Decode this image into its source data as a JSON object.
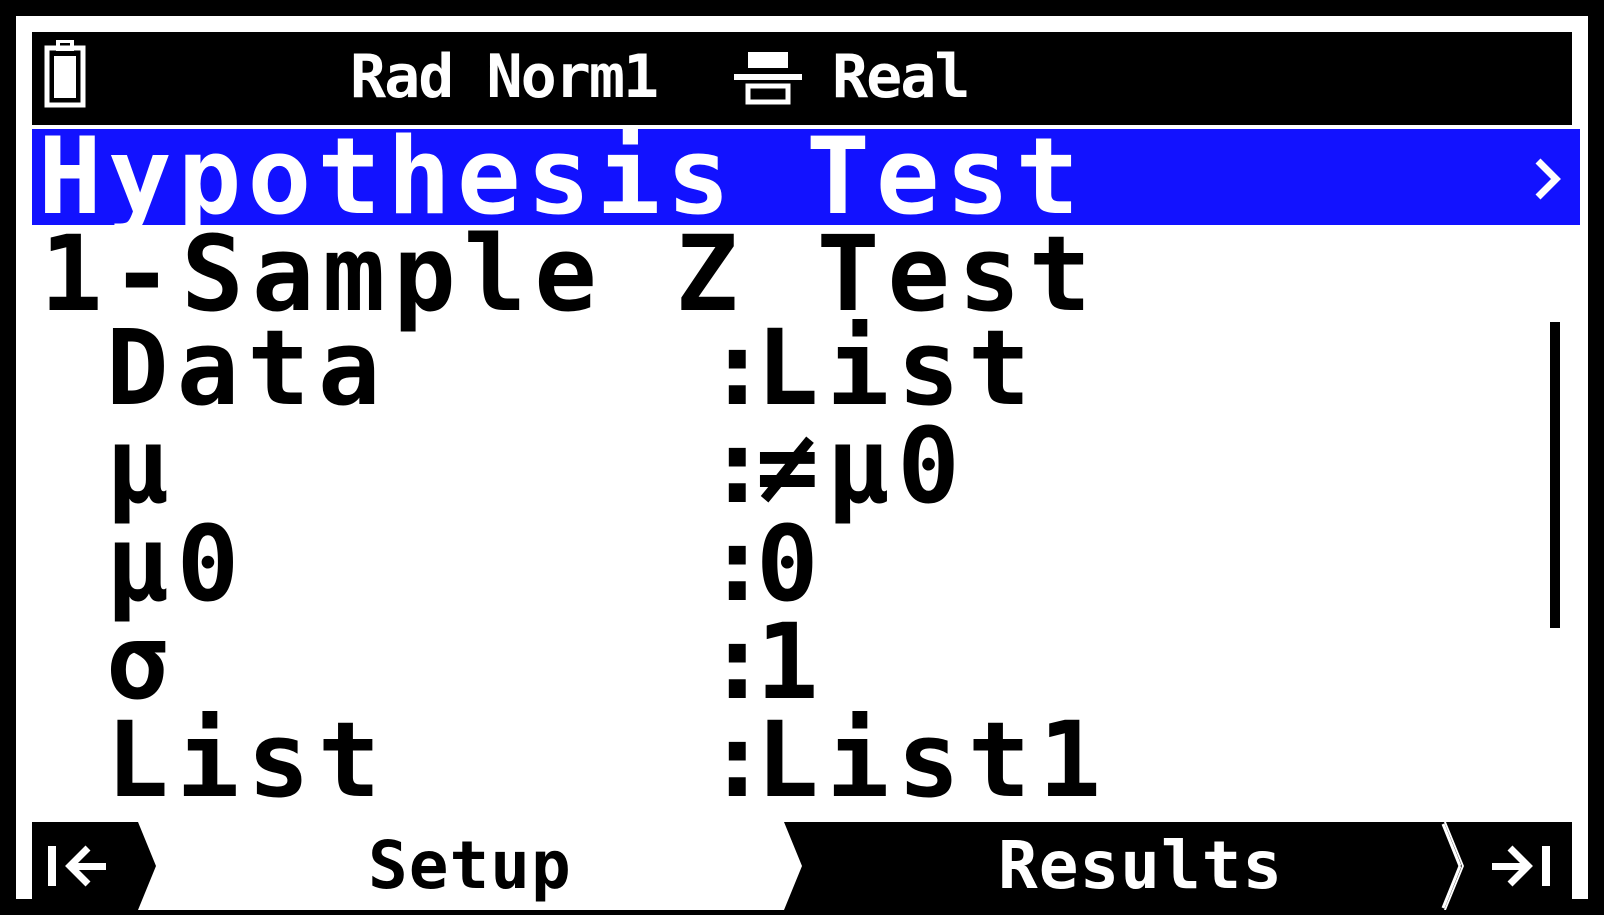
{
  "status": {
    "angle_mode": "Rad",
    "display_mode": "Norm1",
    "complex_mode": "Real",
    "battery_icon": "battery-icon",
    "display_icon": "fraction-display-icon"
  },
  "title": {
    "text": "Hypothesis Test",
    "chevron_icon": "chevron-right-icon"
  },
  "test": {
    "name": "1-Sample Z Test",
    "rows": [
      {
        "label": "Data",
        "value": "List"
      },
      {
        "label": "μ",
        "value": "≠μ0"
      },
      {
        "label": "μ0",
        "value": "0"
      },
      {
        "label": "σ",
        "value": "1"
      },
      {
        "label": "List",
        "value": "List1"
      }
    ],
    "separator": ":"
  },
  "softkeys": {
    "first_icon": "go-to-first-icon",
    "last_icon": "go-to-last-icon",
    "tabs": [
      {
        "label": "Setup",
        "active": false
      },
      {
        "label": "Results",
        "active": true
      }
    ]
  },
  "colors": {
    "title_bar": "#1212ff",
    "status_bar": "#000000",
    "active_tab": "#000000"
  }
}
